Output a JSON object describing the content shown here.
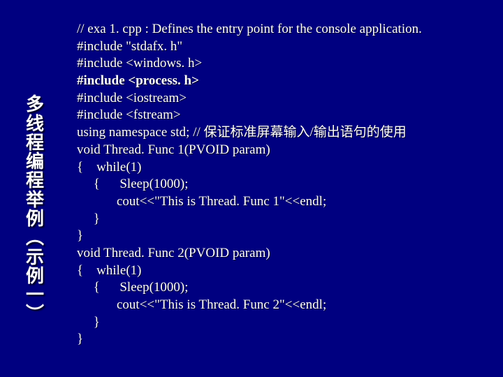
{
  "title_chars": [
    "多",
    "线",
    "程",
    "编",
    "程",
    "举",
    "例",
    "︵",
    "示",
    "例",
    "一",
    "︶"
  ],
  "code": {
    "l01": "// exa 1. cpp : Defines the entry point for the console application.",
    "l02": "#include \"stdafx. h\"",
    "l03": "#include <windows. h>",
    "l04": "#include <process. h>",
    "l05": "#include <iostream>",
    "l06": "#include <fstream>",
    "l07": "using namespace std; // 保证标准屏幕输入/输出语句的使用",
    "l08": "",
    "l09": "void Thread. Func 1(PVOID param)",
    "l10": "{    while(1)",
    "l11": "     {      Sleep(1000);",
    "l12": "            cout<<\"This is Thread. Func 1\"<<endl;",
    "l13": "     }",
    "l14": "}",
    "l15": "void Thread. Func 2(PVOID param)",
    "l16": "{    while(1)",
    "l17": "     {      Sleep(1000);",
    "l18": "            cout<<\"This is Thread. Func 2\"<<endl;",
    "l19": "     }",
    "l20": "}"
  }
}
